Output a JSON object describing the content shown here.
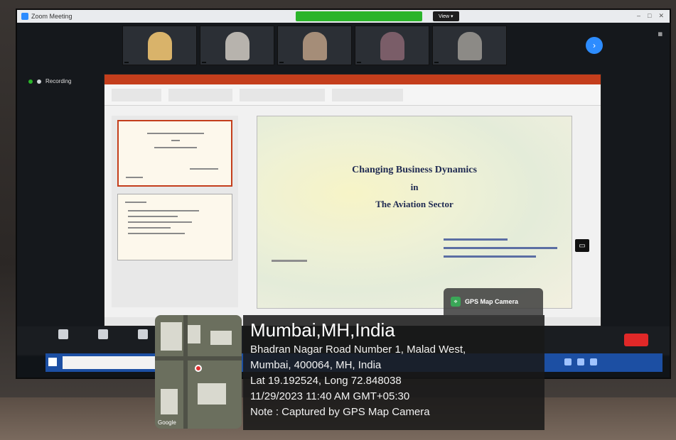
{
  "window": {
    "title": "Zoom Meeting",
    "recording_banner": "",
    "view_button": "View"
  },
  "participants": [
    {
      "name": ""
    },
    {
      "name": ""
    },
    {
      "name": ""
    },
    {
      "name": ""
    },
    {
      "name": ""
    }
  ],
  "active_speaker": {
    "name": "",
    "label": ""
  },
  "recording": {
    "label": "Recording"
  },
  "slide": {
    "title_line1": "Changing Business Dynamics",
    "title_line2": "in",
    "title_line3": "The Aviation Sector"
  },
  "controls": [
    {
      "label": ""
    },
    {
      "label": ""
    },
    {
      "label": ""
    }
  ],
  "end_button": "",
  "gps": {
    "badge": "GPS Map Camera",
    "city": "Mumbai,MH,India",
    "address_line1": "Bhadran Nagar Road Number 1, Malad West,",
    "address_line2": "Mumbai, 400064, MH, India",
    "coords": "Lat 19.192524, Long 72.848038",
    "datetime": "11/29/2023 11:40 AM GMT+05:30",
    "note": "Note : Captured by GPS Map Camera"
  },
  "colors": {
    "zoom_blue": "#2d8cff",
    "ppt_red": "#c43e1c",
    "taskbar_blue": "#1c4fa3",
    "end_red": "#e02828"
  }
}
